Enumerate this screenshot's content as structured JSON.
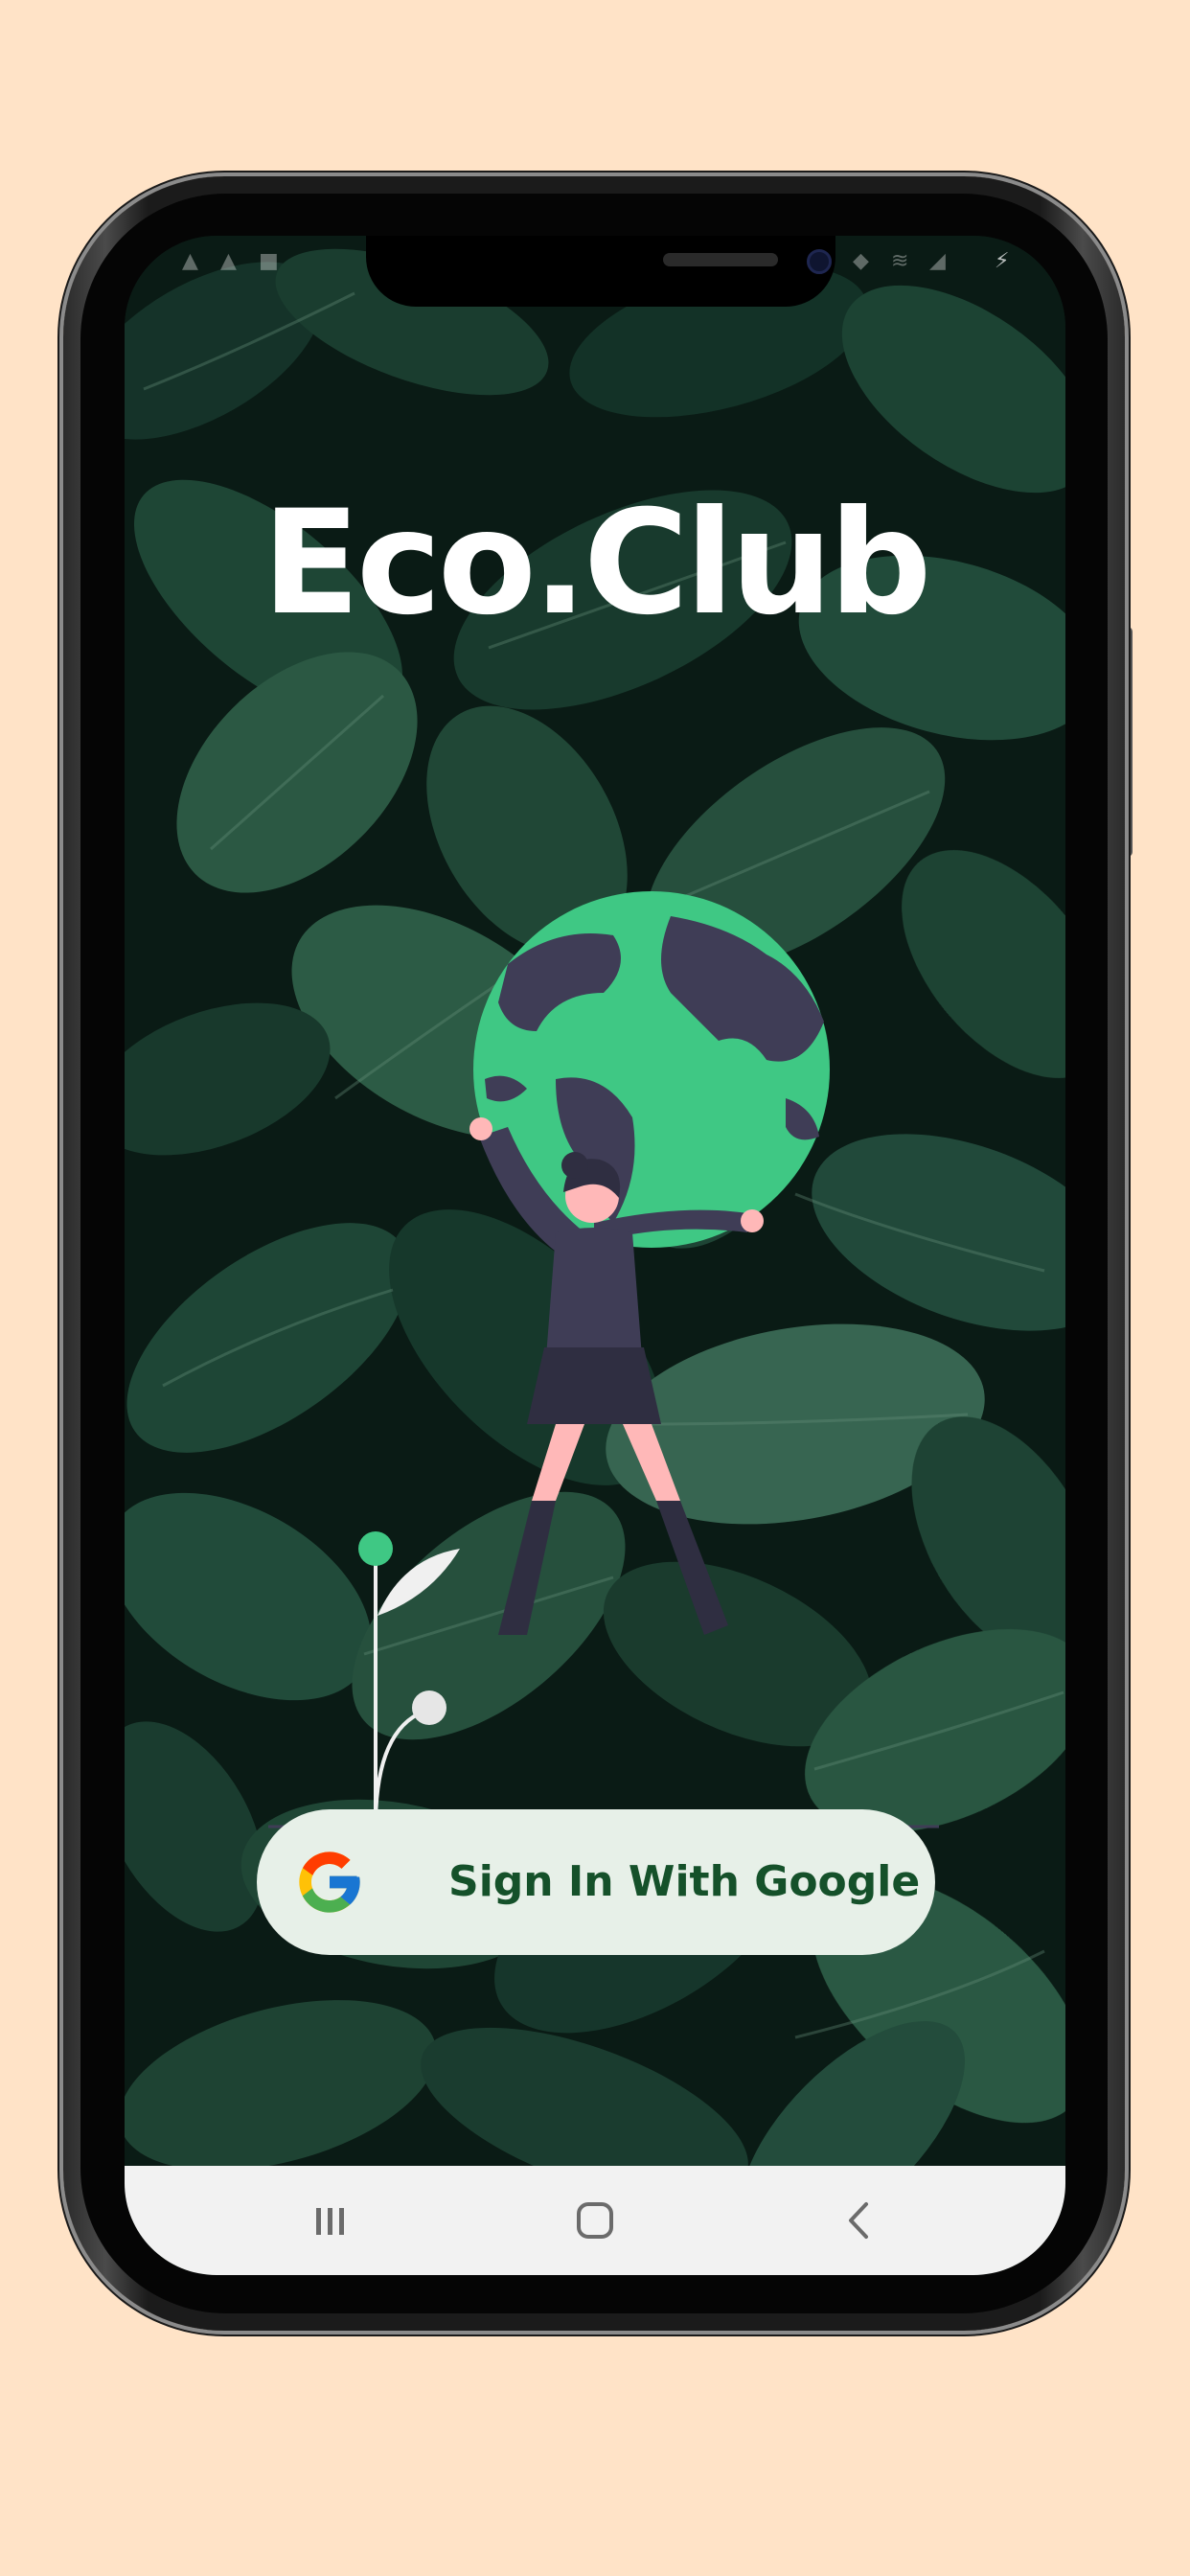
{
  "app": {
    "title": "Eco.Club"
  },
  "auth": {
    "google_button_label": "Sign In With Google",
    "google_icon": "google-g-icon"
  },
  "illustration": {
    "subject": "woman-holding-globe-icon"
  },
  "nav": {
    "recents_icon": "recents-icon",
    "home_icon": "home-icon",
    "back_icon": "back-icon"
  },
  "colors": {
    "page_background": "#ffe3c7",
    "globe_green": "#3fc884",
    "globe_dark": "#3f3d56",
    "button_background": "#e7f0e8",
    "button_text": "#15512a",
    "title_text": "#ffffff"
  }
}
